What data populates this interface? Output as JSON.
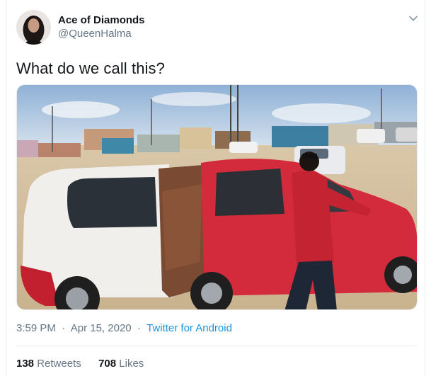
{
  "author": {
    "display_name": "Ace of Diamonds",
    "handle": "@QueenHalma"
  },
  "tweet": {
    "text": "What do we call this?",
    "time": "3:59 PM",
    "separator": "·",
    "date": "Apr 15, 2020",
    "source": "Twitter for Android"
  },
  "stats": {
    "retweets_count": "138",
    "retweets_label": "Retweets",
    "likes_count": "708",
    "likes_label": "Likes"
  },
  "colors": {
    "handle_gray": "#657786",
    "link_blue": "#1b95e0",
    "text_dark": "#14171a"
  },
  "icons": {
    "menu": "chevron-down-icon"
  }
}
